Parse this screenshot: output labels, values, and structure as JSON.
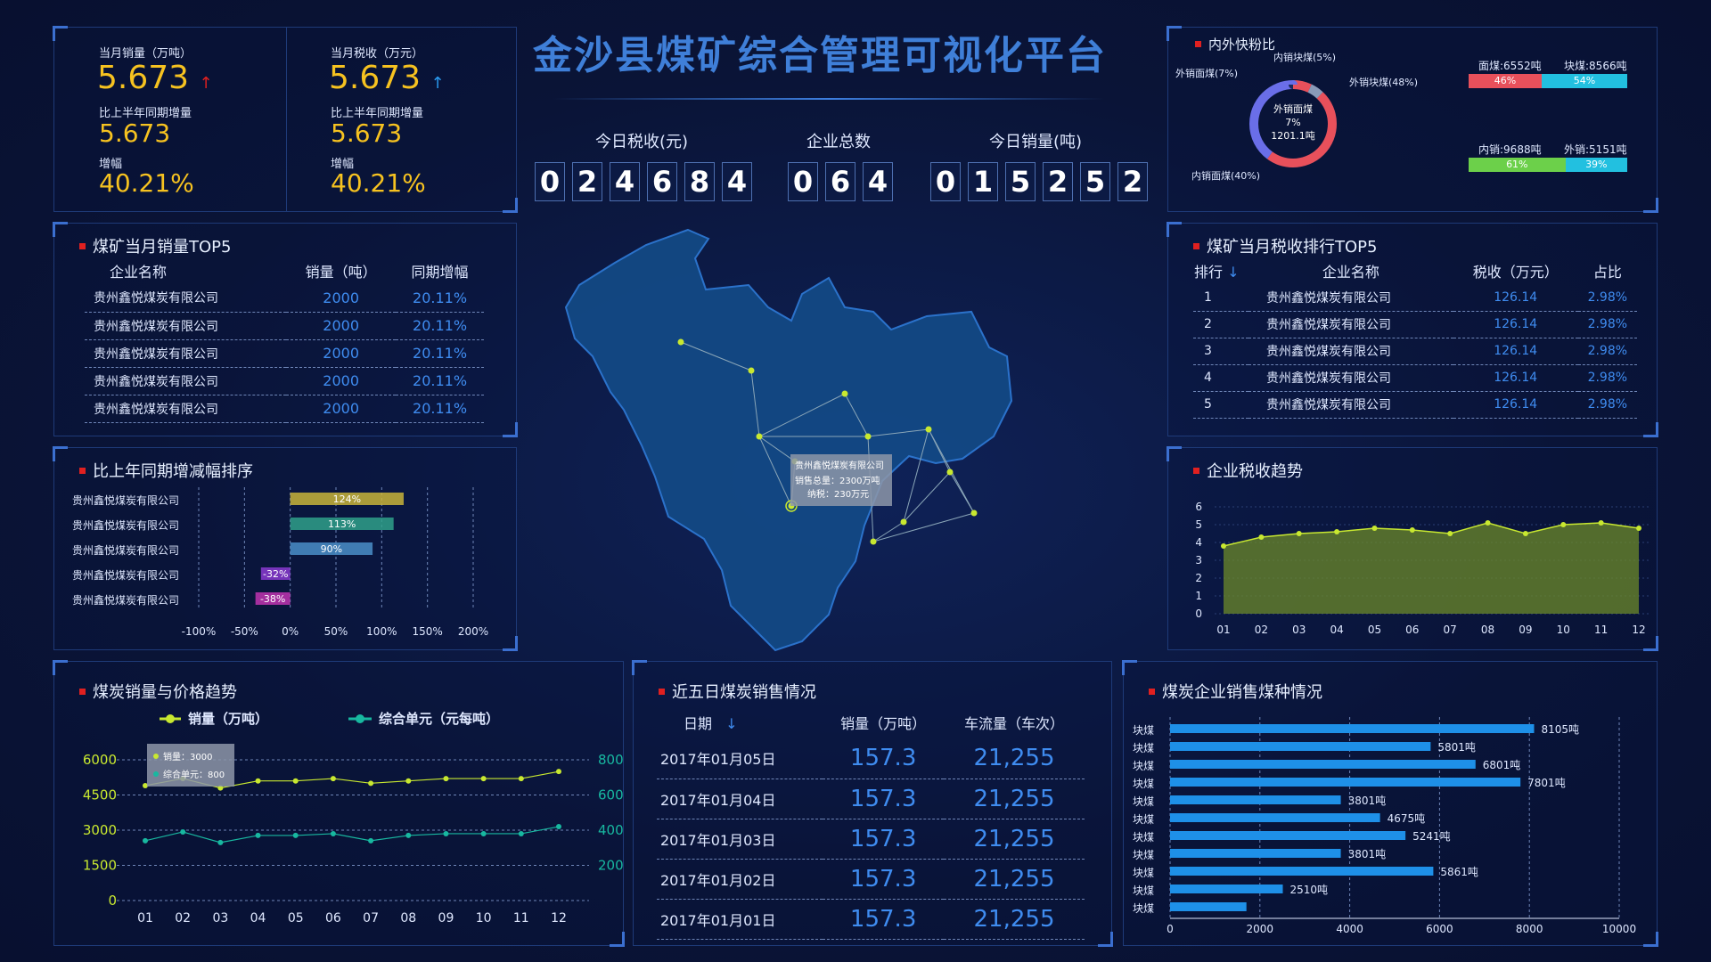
{
  "title": "金沙县煤矿综合管理可视化平台",
  "kpi": {
    "sales_label": "当月销量（万吨）",
    "sales_value": "5.673",
    "sales_arrow": "↑",
    "sales_yoy_label": "比上半年同期增量",
    "sales_yoy_value": "5.673",
    "sales_growth_label": "增幅",
    "sales_growth_value": "40.21%",
    "tax_label": "当月税收（万元）",
    "tax_value": "5.673",
    "tax_arrow": "↑",
    "tax_yoy_label": "比上半年同期增量",
    "tax_yoy_value": "5.673",
    "tax_growth_label": "增幅",
    "tax_growth_value": "40.21%"
  },
  "counters": {
    "tax_today_label": "今日税收(元)",
    "tax_today_digits": [
      "0",
      "2",
      "4",
      "6",
      "8",
      "4"
    ],
    "company_label": "企业总数",
    "company_digits": [
      "0",
      "6",
      "4"
    ],
    "sales_today_label": "今日销量(吨)",
    "sales_today_digits": [
      "0",
      "1",
      "5",
      "2",
      "5",
      "2"
    ]
  },
  "top5_sales": {
    "title": "煤矿当月销量TOP5",
    "headers": [
      "企业名称",
      "销量（吨）",
      "同期增幅"
    ],
    "rows": [
      [
        "贵州鑫悦煤炭有限公司",
        "2000",
        "20.11%"
      ],
      [
        "贵州鑫悦煤炭有限公司",
        "2000",
        "20.11%"
      ],
      [
        "贵州鑫悦煤炭有限公司",
        "2000",
        "20.11%"
      ],
      [
        "贵州鑫悦煤炭有限公司",
        "2000",
        "20.11%"
      ],
      [
        "贵州鑫悦煤炭有限公司",
        "2000",
        "20.11%"
      ]
    ]
  },
  "growth_rank": {
    "title": "比上年同期增减幅排序",
    "names": [
      "贵州鑫悦煤炭有限公司",
      "贵州鑫悦煤炭有限公司",
      "贵州鑫悦煤炭有限公司",
      "贵州鑫悦煤炭有限公司",
      "贵州鑫悦煤炭有限公司"
    ],
    "labels": [
      "124%",
      "113%",
      "90%",
      "-32%",
      "-38%"
    ],
    "values": [
      124,
      113,
      90,
      -32,
      -38
    ],
    "colors": [
      "#c8b43a",
      "#2fa08a",
      "#4a8ec8",
      "#8a3ad0",
      "#c034b0"
    ],
    "ticks": [
      "-100%",
      "-50%",
      "0%",
      "50%",
      "100%",
      "150%",
      "200%"
    ],
    "tick_values": [
      -100,
      -50,
      0,
      50,
      100,
      150,
      200
    ]
  },
  "map": {
    "tooltip_title": "贵州鑫悦煤炭有限公司",
    "tooltip_line1": "销售总量：2300万吨",
    "tooltip_line2": "纳税：230万元"
  },
  "ratio": {
    "title": "内外快粉比",
    "center_line1": "外销面煤",
    "center_line2": "7%",
    "center_line3": "1201.1吨",
    "label_out_fine": "外销面煤(7%)",
    "label_in_lump": "内销块煤(5%)",
    "label_out_lump": "外销块煤(48%)",
    "label_in_fine": "内销面煤(40%)",
    "bar1_left_label": "面煤:6552吨",
    "bar1_right_label": "块煤:8566吨",
    "bar1_left_pct": "46%",
    "bar1_right_pct": "54%",
    "bar1_left_value": 46,
    "bar2_left_label": "内销:9688吨",
    "bar2_right_label": "外销:5151吨",
    "bar2_left_pct": "61%",
    "bar2_right_pct": "39%",
    "bar2_left_value": 61,
    "colors": {
      "red": "#e8505b",
      "cyan": "#22c0e0",
      "green": "#6cd04a"
    }
  },
  "top5_tax": {
    "title": "煤矿当月税收排行TOP5",
    "headers": [
      "排行",
      "企业名称",
      "税收（万元）",
      "占比"
    ],
    "sort_arrow": "↓",
    "rows": [
      [
        "1",
        "贵州鑫悦煤炭有限公司",
        "126.14",
        "2.98%"
      ],
      [
        "2",
        "贵州鑫悦煤炭有限公司",
        "126.14",
        "2.98%"
      ],
      [
        "3",
        "贵州鑫悦煤炭有限公司",
        "126.14",
        "2.98%"
      ],
      [
        "4",
        "贵州鑫悦煤炭有限公司",
        "126.14",
        "2.98%"
      ],
      [
        "5",
        "贵州鑫悦煤炭有限公司",
        "126.14",
        "2.98%"
      ]
    ]
  },
  "tax_trend": {
    "title": "企业税收趋势",
    "x": [
      "01",
      "02",
      "03",
      "04",
      "05",
      "06",
      "07",
      "08",
      "09",
      "10",
      "11",
      "12"
    ],
    "y": [
      3.8,
      4.3,
      4.5,
      4.6,
      4.8,
      4.7,
      4.5,
      5.1,
      4.5,
      5.0,
      5.1,
      4.8
    ],
    "yticks": [
      "0",
      "1",
      "2",
      "3",
      "4",
      "5",
      "6"
    ],
    "ylim": [
      0,
      6
    ]
  },
  "sales_price": {
    "title": "煤炭销量与价格趋势",
    "legend_sales": "销量（万吨）",
    "legend_price": "综合单元（元每吨）",
    "tooltip_sales": "销量：3000",
    "tooltip_price": "综合单元：800",
    "x": [
      "01",
      "02",
      "03",
      "04",
      "05",
      "06",
      "07",
      "08",
      "09",
      "10",
      "11",
      "12"
    ],
    "sales": [
      4900,
      5200,
      4800,
      5100,
      5100,
      5200,
      5000,
      5100,
      5200,
      5200,
      5200,
      5500
    ],
    "price": [
      340,
      390,
      330,
      370,
      370,
      380,
      340,
      370,
      380,
      380,
      380,
      420
    ],
    "yleft": [
      "6000",
      "4500",
      "3000",
      "1500",
      "0"
    ],
    "yright": [
      "800",
      "600",
      "400",
      "200"
    ],
    "colors": {
      "sales": "#c8e830",
      "price": "#18b8a0"
    }
  },
  "five_days": {
    "title": "近五日煤炭销售情况",
    "headers": [
      "日期",
      "销量（万吨）",
      "车流量（车次）"
    ],
    "sort_arrow": "↓",
    "rows": [
      [
        "2017年01月05日",
        "157.3",
        "21,255"
      ],
      [
        "2017年01月04日",
        "157.3",
        "21,255"
      ],
      [
        "2017年01月03日",
        "157.3",
        "21,255"
      ],
      [
        "2017年01月02日",
        "157.3",
        "21,255"
      ],
      [
        "2017年01月01日",
        "157.3",
        "21,255"
      ]
    ]
  },
  "coal_types": {
    "title": "煤炭企业销售煤种情况",
    "categories": [
      "块煤",
      "块煤",
      "块煤",
      "块煤",
      "块煤",
      "块煤",
      "块煤",
      "块煤",
      "块煤",
      "块煤",
      "块煤"
    ],
    "values": [
      8105,
      5801,
      6801,
      7801,
      3801,
      4675,
      5241,
      3801,
      5861,
      2510,
      1700
    ],
    "value_labels": [
      "8105吨",
      "5801吨",
      "6801吨",
      "7801吨",
      "3801吨",
      "4675吨",
      "5241吨",
      "3801吨",
      "5861吨",
      "2510吨",
      ""
    ],
    "xticks": [
      "0",
      "2000",
      "4000",
      "6000",
      "8000",
      "10000"
    ],
    "xmax": 10000
  },
  "chart_data": [
    {
      "type": "bar",
      "title": "比上年同期增减幅排序",
      "categories": [
        "贵州鑫悦煤炭有限公司",
        "贵州鑫悦煤炭有限公司",
        "贵州鑫悦煤炭有限公司",
        "贵州鑫悦煤炭有限公司",
        "贵州鑫悦煤炭有限公司"
      ],
      "values": [
        124,
        113,
        90,
        -32,
        -38
      ],
      "xlim": [
        -100,
        200
      ]
    },
    {
      "type": "area",
      "title": "企业税收趋势",
      "x": [
        "01",
        "02",
        "03",
        "04",
        "05",
        "06",
        "07",
        "08",
        "09",
        "10",
        "11",
        "12"
      ],
      "values": [
        3.8,
        4.3,
        4.5,
        4.6,
        4.8,
        4.7,
        4.5,
        5.1,
        4.5,
        5.0,
        5.1,
        4.8
      ],
      "ylim": [
        0,
        6
      ]
    },
    {
      "type": "line",
      "title": "煤炭销量与价格趋势",
      "x": [
        "01",
        "02",
        "03",
        "04",
        "05",
        "06",
        "07",
        "08",
        "09",
        "10",
        "11",
        "12"
      ],
      "series": [
        {
          "name": "销量（万吨）",
          "values": [
            4900,
            5200,
            4800,
            5100,
            5100,
            5200,
            5000,
            5100,
            5200,
            5200,
            5200,
            5500
          ]
        },
        {
          "name": "综合单元（元每吨）",
          "values": [
            340,
            390,
            330,
            370,
            370,
            380,
            340,
            370,
            380,
            380,
            380,
            420
          ]
        }
      ],
      "ylim": [
        0,
        6000
      ],
      "y2lim": [
        0,
        800
      ]
    },
    {
      "type": "bar",
      "title": "煤炭企业销售煤种情况",
      "categories": [
        "块煤",
        "块煤",
        "块煤",
        "块煤",
        "块煤",
        "块煤",
        "块煤",
        "块煤",
        "块煤",
        "块煤",
        "块煤"
      ],
      "values": [
        8105,
        5801,
        6801,
        7801,
        3801,
        4675,
        5241,
        3801,
        5861,
        2510,
        1700
      ],
      "xlim": [
        0,
        10000
      ]
    },
    {
      "type": "pie",
      "title": "内外快粉比",
      "categories": [
        "外销面煤",
        "内销块煤",
        "外销块煤",
        "内销面煤"
      ],
      "values": [
        7,
        5,
        48,
        40
      ]
    }
  ]
}
